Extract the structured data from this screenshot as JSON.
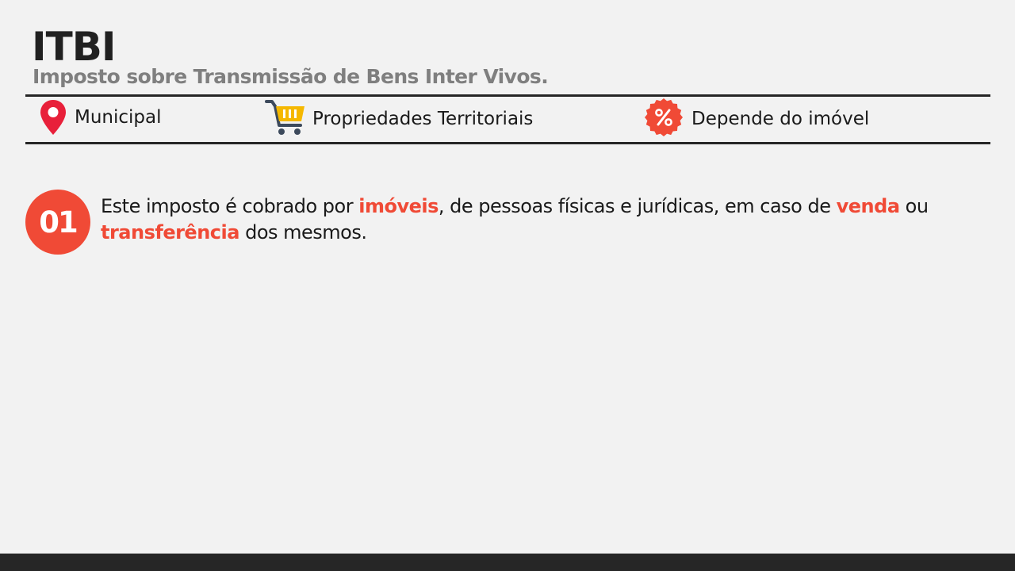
{
  "header": {
    "title": "ITBI",
    "subtitle": "Imposto sobre Transmissão de Bens Inter Vivos."
  },
  "info_bar": {
    "items": [
      {
        "icon": "location-pin-icon",
        "label": "Municipal"
      },
      {
        "icon": "shopping-cart-icon",
        "label": "Propriedades Territoriais"
      },
      {
        "icon": "percent-badge-icon",
        "label": "Depende do imóvel"
      }
    ]
  },
  "points": [
    {
      "number": "01",
      "text_parts": [
        "Este imposto é cobrado por ",
        "imóveis",
        ", de pessoas físicas e jurídicas, em caso de ",
        "venda",
        " ou ",
        "transferência",
        " dos mesmos."
      ]
    }
  ],
  "colors": {
    "accent": "#f04a36",
    "pin": "#e8203a",
    "cart_basket": "#f5b800",
    "cart_frame": "#3d4a5c",
    "background": "#f2f2f2",
    "rule": "#262626",
    "subtitle": "#7f7f7f"
  }
}
